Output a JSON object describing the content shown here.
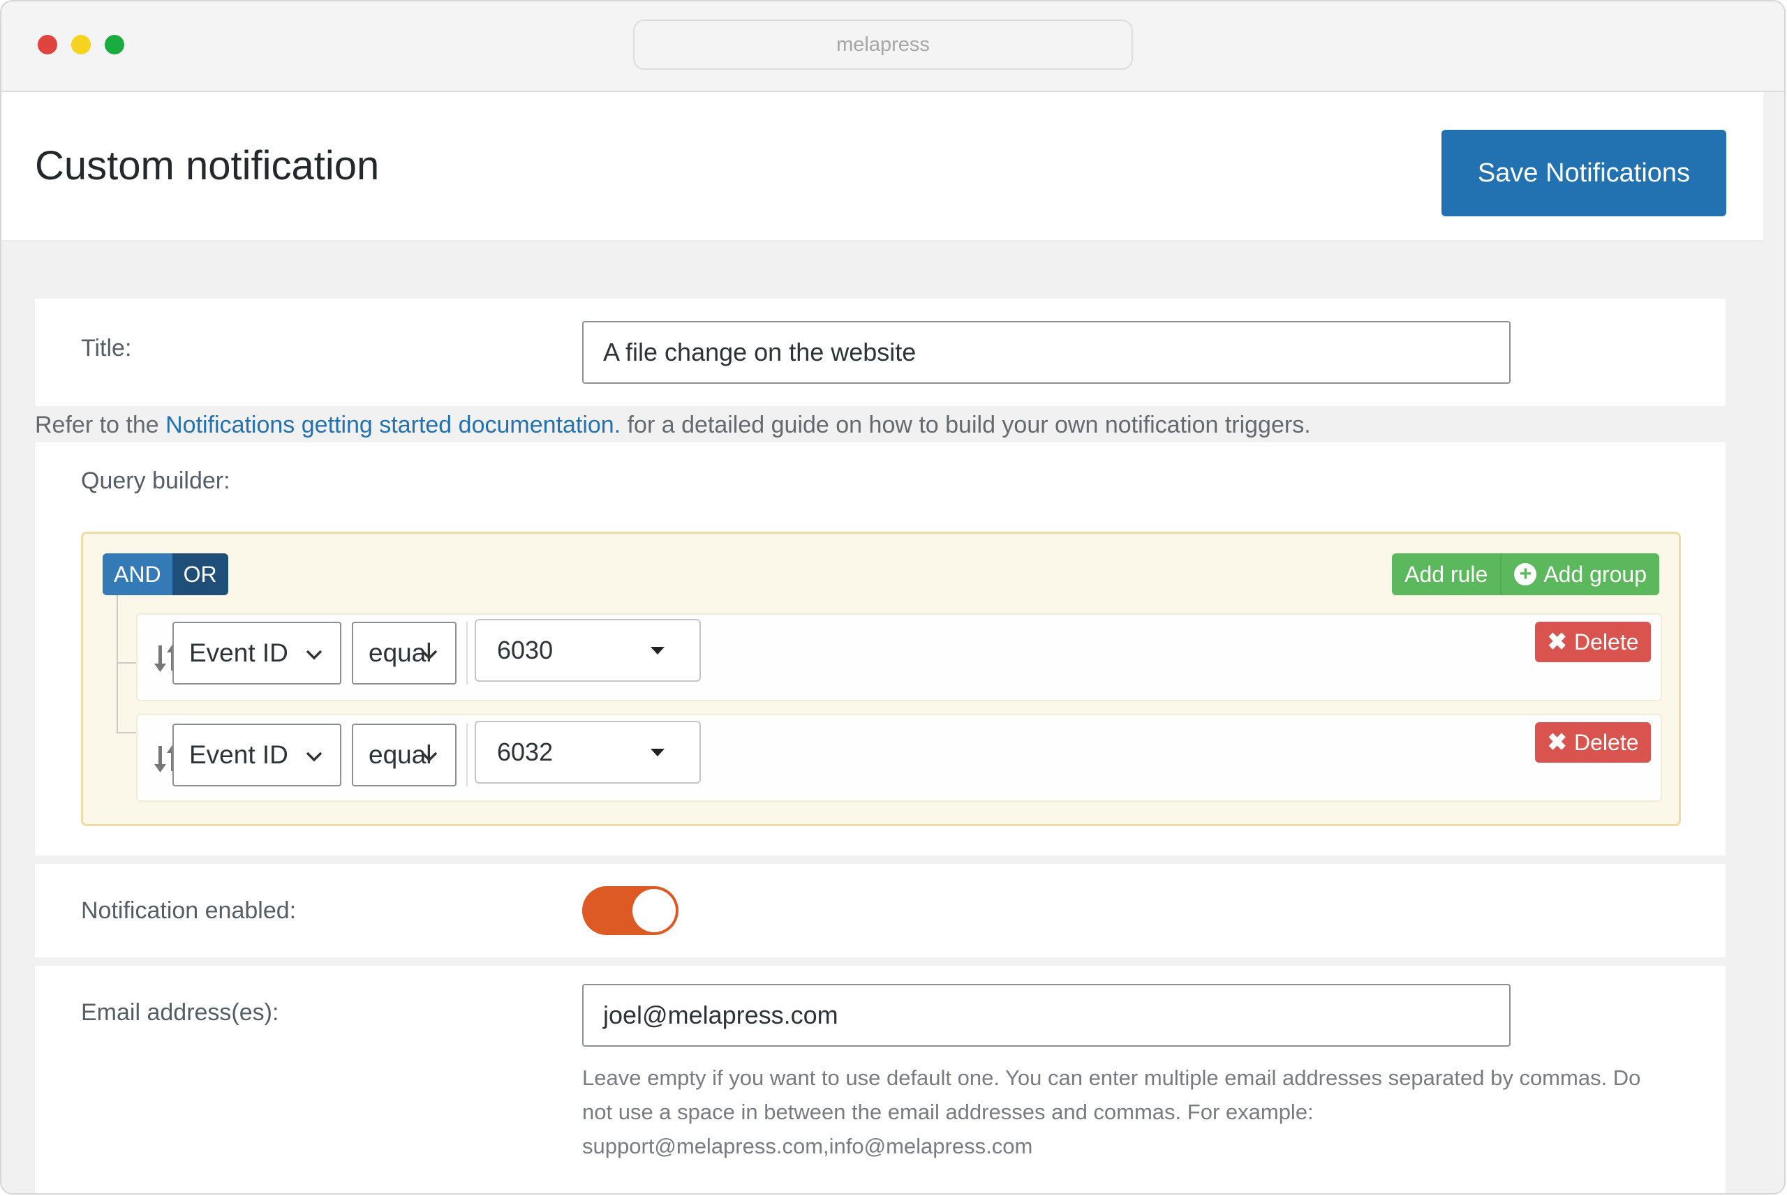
{
  "browser": {
    "url": "melapress"
  },
  "header": {
    "title": "Custom notification",
    "save_label": "Save Notifications"
  },
  "form": {
    "title_label": "Title:",
    "title_value": "A file change on the website",
    "refer": {
      "before": "Refer to the ",
      "link": "Notifications getting started documentation.",
      "after": " for a detailed guide on how to build your own notification triggers."
    },
    "query_builder_label": "Query builder:",
    "notification_enabled_label": "Notification enabled:",
    "notification_enabled": true,
    "email_label": "Email address(es):",
    "email_value": "joel@melapress.com",
    "email_help": "Leave empty if you want to use default one. You can enter multiple email addresses separated by commas. Do not use a space in between the email addresses and commas. For example: support@melapress.com,info@melapress.com"
  },
  "query_builder": {
    "and_label": "AND",
    "or_label": "OR",
    "add_rule_label": "Add rule",
    "add_group_label": "Add group",
    "rules": [
      {
        "field": "Event ID",
        "operator": "equal",
        "value": "6030",
        "delete_label": "Delete"
      },
      {
        "field": "Event ID",
        "operator": "equal",
        "value": "6032",
        "delete_label": "Delete"
      }
    ]
  },
  "colors": {
    "primary": "#2271b1",
    "and_active": "#337ab7",
    "add_buttons": "#5cb85c",
    "delete": "#d9534f",
    "toggle_on": "#de5a24",
    "group_background": "#fcf8e9"
  }
}
